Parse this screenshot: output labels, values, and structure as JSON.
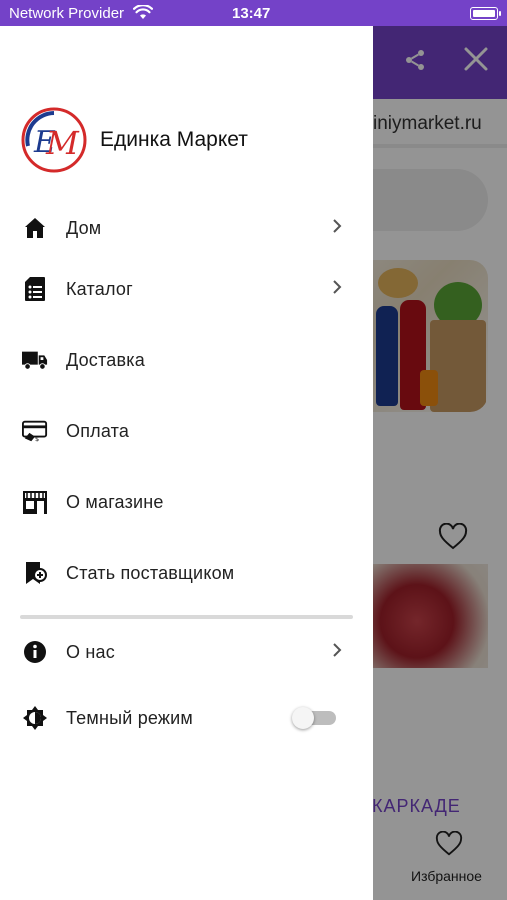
{
  "status_bar": {
    "carrier": "Network Provider",
    "time": "13:47"
  },
  "background": {
    "url_text": "iniymarket.ru",
    "section_label": "КАРКАДЕ",
    "tab_favorites_label": "Избранное",
    "accent_color": "#7442c8"
  },
  "drawer": {
    "brand_name": "Единка Маркет",
    "menu": [
      {
        "label": "Дом",
        "icon": "home-icon",
        "has_chevron": true
      },
      {
        "label": "Каталог",
        "icon": "catalog-icon",
        "has_chevron": true
      },
      {
        "label": "Доставка",
        "icon": "truck-icon",
        "has_chevron": false
      },
      {
        "label": "Оплата",
        "icon": "payment-card-icon",
        "has_chevron": false
      },
      {
        "label": "О магазине",
        "icon": "store-icon",
        "has_chevron": false
      },
      {
        "label": "Стать поставщиком",
        "icon": "supplier-add-icon",
        "has_chevron": false
      }
    ],
    "secondary": [
      {
        "label": "О нас",
        "icon": "info-icon",
        "has_chevron": true
      },
      {
        "label": "Темный режим",
        "icon": "brightness-icon",
        "toggle_on": false
      }
    ]
  }
}
